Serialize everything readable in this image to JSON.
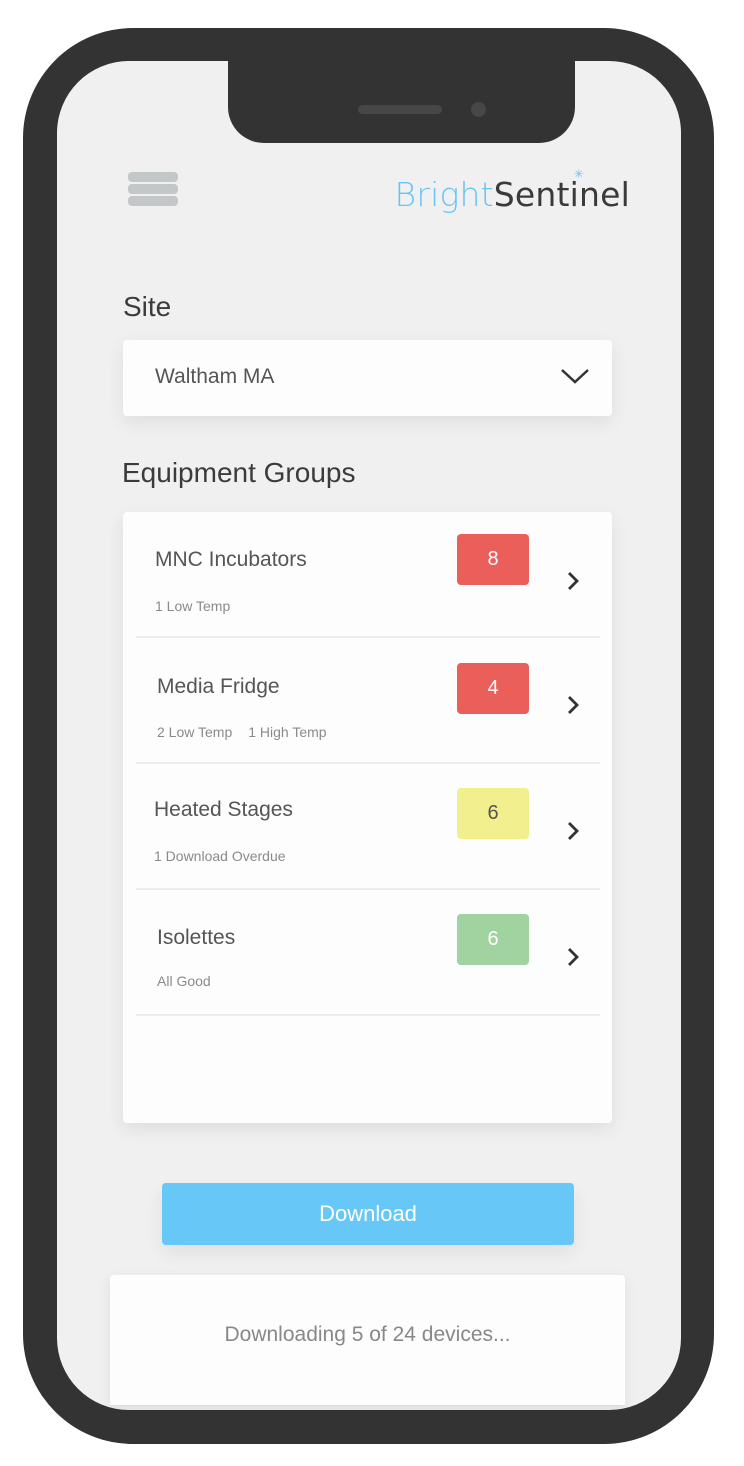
{
  "app": {
    "brand_part1": "Bright",
    "brand_part2": "Sentinel",
    "brand_color": "#67c4f4"
  },
  "header": {
    "menu_icon": "hamburger-menu-icon"
  },
  "site": {
    "label": "Site",
    "selected": "Waltham MA",
    "icon": "chevron-down-icon"
  },
  "equipment": {
    "label": "Equipment Groups",
    "groups": [
      {
        "name": "MNC Incubators",
        "count": "8",
        "status": "alarm",
        "color": "#eb5f5a",
        "details": [
          "1 Low Temp"
        ]
      },
      {
        "name": "Media Fridge",
        "count": "4",
        "status": "alarm",
        "color": "#eb5f5a",
        "details": [
          "2 Low Temp",
          "1 High Temp"
        ]
      },
      {
        "name": "Heated Stages",
        "count": "6",
        "status": "warning",
        "color": "#f2ef8e",
        "details": [
          "1 Download Overdue"
        ]
      },
      {
        "name": "Isolettes",
        "count": "6",
        "status": "ok",
        "color": "#a0d39f",
        "details": [
          "All Good"
        ]
      }
    ]
  },
  "download": {
    "button_label": "Download",
    "button_color": "#67c8f8",
    "status_text": "Downloading 5 of 24 devices...",
    "progress": {
      "current": 5,
      "total": 24
    }
  }
}
